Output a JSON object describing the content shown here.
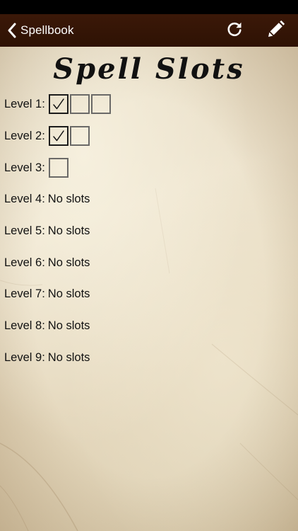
{
  "nav": {
    "back_label": "Spellbook"
  },
  "page": {
    "title": "Spell Slots"
  },
  "levels": [
    {
      "label": "Level 1:",
      "slots": [
        true,
        false,
        false
      ],
      "no_slots_text": ""
    },
    {
      "label": "Level 2:",
      "slots": [
        true,
        false
      ],
      "no_slots_text": ""
    },
    {
      "label": "Level 3:",
      "slots": [
        false
      ],
      "no_slots_text": ""
    },
    {
      "label": "Level 4:",
      "slots": [],
      "no_slots_text": "No slots"
    },
    {
      "label": "Level 5:",
      "slots": [],
      "no_slots_text": "No slots"
    },
    {
      "label": "Level 6:",
      "slots": [],
      "no_slots_text": "No slots"
    },
    {
      "label": "Level 7:",
      "slots": [],
      "no_slots_text": "No slots"
    },
    {
      "label": "Level 8:",
      "slots": [],
      "no_slots_text": "No slots"
    },
    {
      "label": "Level 9:",
      "slots": [],
      "no_slots_text": "No slots"
    }
  ],
  "icons": {
    "back": "chevron-left-icon",
    "refresh": "refresh-icon",
    "edit": "pencil-icon",
    "check": "checkmark-icon"
  },
  "colors": {
    "nav_background": "#2e1204",
    "parchment": "#e6dbc3",
    "text": "#111111"
  }
}
